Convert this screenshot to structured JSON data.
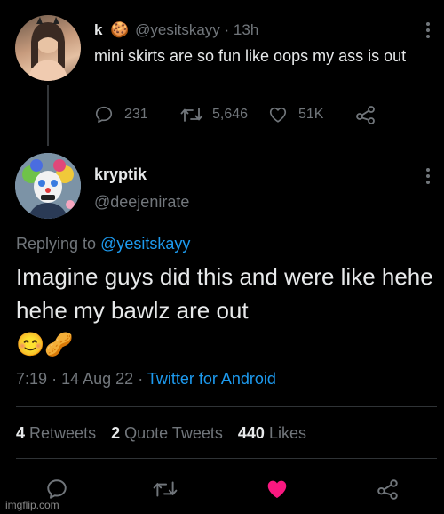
{
  "quoted_tweet": {
    "display_name": "k",
    "name_emoji": "🍪",
    "handle": "@yesitskayy",
    "separator": "·",
    "time": "13h",
    "text": "mini skirts are so fun like oops my ass is out",
    "stats": {
      "replies": "231",
      "retweets": "5,646",
      "likes": "51K"
    }
  },
  "reply_tweet": {
    "display_name": "kryptik",
    "handle": "@deejenirate",
    "replying_prefix": "Replying to",
    "replying_to": "@yesitskayy",
    "text": "Imagine guys did this and were like hehe hehe my bawlz are out",
    "emojis": "😊🥜",
    "time": "7:19",
    "date": "14 Aug 22",
    "separator": "·",
    "source": "Twitter for Android"
  },
  "engagement": {
    "retweets_count": "4",
    "retweets_label": "Retweets",
    "quotes_count": "2",
    "quotes_label": "Quote Tweets",
    "likes_count": "440",
    "likes_label": "Likes"
  },
  "icons": {
    "reply": "reply-icon",
    "retweet": "retweet-icon",
    "like": "heart-icon",
    "share": "share-icon",
    "more": "more-icon"
  },
  "colors": {
    "background": "#000000",
    "text": "#e7e9ea",
    "muted": "#71767b",
    "link": "#1d9bf0",
    "like_active": "#f91880"
  },
  "watermark": "imgflip.com"
}
